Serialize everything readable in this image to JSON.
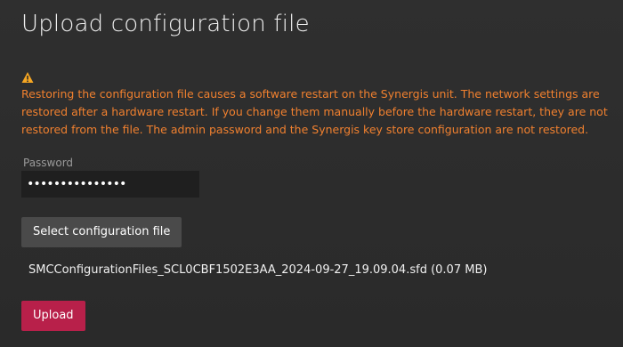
{
  "dialog": {
    "title": "Upload configuration file"
  },
  "warning": {
    "icon": "warning-icon",
    "color": "#f0802f",
    "message": "Restoring the configuration file causes a software restart on the Synergis unit. The network settings are restored after a hardware restart. If you change them manually before the hardware restart, they are not restored from the file. The admin password and the Synergis key store configuration are not restored."
  },
  "password": {
    "label": "Password",
    "value": "•••••••••••••••"
  },
  "select_file": {
    "label": "Select configuration file"
  },
  "selected_file": {
    "text": "SMCConfigurationFiles_SCL0CBF1502E3AA_2024-09-27_19.09.04.sfd (0.07 MB)"
  },
  "upload": {
    "label": "Upload",
    "color": "#b8204a"
  }
}
